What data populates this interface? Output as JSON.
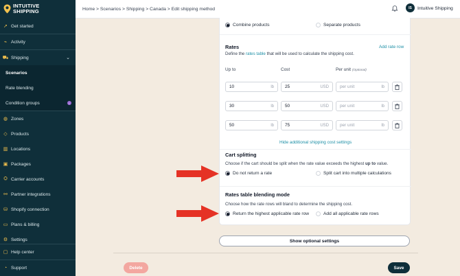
{
  "brand": {
    "line1": "INTUITIVE",
    "line2": "SHIPPING"
  },
  "sidebar": {
    "items": [
      {
        "label": "Get started",
        "icon": "rocket-icon"
      },
      {
        "label": "Activity",
        "icon": "activity-icon"
      },
      {
        "label": "Shipping",
        "icon": "truck-icon"
      },
      {
        "label": "Scenarios",
        "sub": true,
        "active": true
      },
      {
        "label": "Rate blending",
        "sub": true
      },
      {
        "label": "Condition groups",
        "sub": true,
        "badge": "i"
      },
      {
        "label": "Zones",
        "icon": "globe-icon"
      },
      {
        "label": "Products",
        "icon": "tag-icon"
      },
      {
        "label": "Locations",
        "icon": "building-icon"
      },
      {
        "label": "Packages",
        "icon": "box-icon"
      },
      {
        "label": "Carrier accounts",
        "icon": "carrier-icon"
      },
      {
        "label": "Partner integrations",
        "icon": "plug-icon"
      },
      {
        "label": "Shopify connection",
        "icon": "shopify-icon"
      },
      {
        "label": "Plans & billing",
        "icon": "card-icon"
      },
      {
        "label": "Settings",
        "icon": "gear-icon"
      }
    ],
    "bottom": [
      {
        "label": "Help center",
        "icon": "help-icon"
      },
      {
        "label": "Support",
        "icon": "support-icon"
      }
    ]
  },
  "header": {
    "breadcrumb": "Home > Scenarios > Shipping > Canada > Edit shipping method",
    "user_initials": "IS",
    "user_name": "Intuitive Shipping"
  },
  "combine": {
    "option1": "Combine products",
    "option2": "Separate products"
  },
  "rates": {
    "title": "Rates",
    "add_link": "Add rate row",
    "desc_prefix": "Define the ",
    "desc_link": "rates table",
    "desc_suffix": " that will be used to calculate the shipping cost.",
    "col_upto": "Up to",
    "col_cost": "Cost",
    "col_per_unit": "Per unit",
    "col_optional": "(Optional)",
    "rows": [
      {
        "upto": "10",
        "upto_unit": "lb",
        "cost": "25",
        "cost_unit": "USD",
        "per_unit_ph": "per unit",
        "per_unit_unit": "lb"
      },
      {
        "upto": "30",
        "upto_unit": "lb",
        "cost": "50",
        "cost_unit": "USD",
        "per_unit_ph": "per unit",
        "per_unit_unit": "lb"
      },
      {
        "upto": "50",
        "upto_unit": "lb",
        "cost": "75",
        "cost_unit": "USD",
        "per_unit_ph": "per unit",
        "per_unit_unit": "lb"
      }
    ],
    "hide_link": "Hide additional shipping cost settings"
  },
  "cart_splitting": {
    "title": "Cart splitting",
    "desc_prefix": "Choose if the cart should be split when the rate value exceeds the highest ",
    "desc_bold": "up to",
    "desc_suffix": " value.",
    "option1": "Do not return a rate",
    "option2": "Split cart into multiple calculations"
  },
  "blending": {
    "title": "Rates table blending mode",
    "desc": "Choose how the rate rows will bland to determine the shipping cost.",
    "option1": "Return the highest applicable rate row",
    "option2": "Add all applicable rate rows"
  },
  "actions": {
    "optional": "Show optional settings",
    "delete": "Delete",
    "save": "Save"
  },
  "colors": {
    "accent": "#1d8fa6",
    "sidebar": "#0f2f3a",
    "arrow": "#e53225",
    "delete": "#f3a7a0"
  }
}
